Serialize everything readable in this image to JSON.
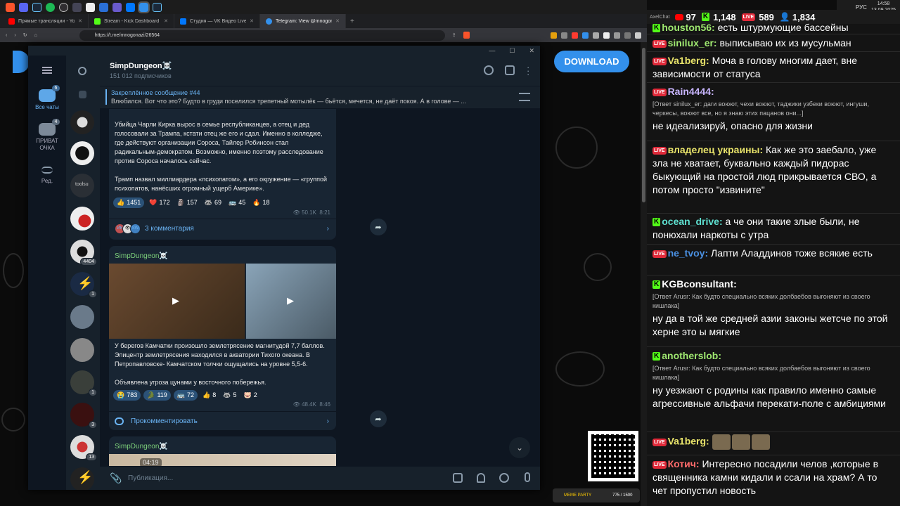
{
  "taskbar": {
    "icons": [
      "brave",
      "discord",
      "steam",
      "spotify",
      "obs",
      "steam-app",
      "epic",
      "telegram",
      "vk",
      "telegram-active",
      "steam2"
    ],
    "tray": {
      "lang": "РУС",
      "time": "14:58",
      "date": "13.09.2025"
    }
  },
  "browser": {
    "tabs": [
      {
        "label": "Прямые трансляции - YouTube Studio",
        "color": "#ff0000"
      },
      {
        "label": "Stream - Kick Dashboard",
        "color": "#53fc18"
      },
      {
        "label": "Студия — VK Видео Live",
        "color": "#0077ff"
      },
      {
        "label": "Telegram: View @mnogonazi",
        "color": "#3390ec"
      }
    ],
    "url": "https://t.me/mnogonazi/26564"
  },
  "webpage": {
    "download_label": "DOWNLOAD"
  },
  "telegram": {
    "rail": [
      {
        "label": "Все чаты",
        "badge": "6"
      },
      {
        "label": "ПРИВАТ\nОЧКА",
        "badge": "4"
      },
      {
        "label": "Ред.",
        "badge": ""
      }
    ],
    "chat_badges": [
      "4404",
      "1",
      "1",
      "3",
      "13"
    ],
    "chat_title": "SimpDungeon☠️",
    "subscribers": "151 012 подписчиков",
    "pinned_title": "Закреплённое сообщение #44",
    "pinned_text": "Влюбился.   Вот что это? Будто в груди поселился трепетный мотылёк — бьётся, мечется, не даёт покоя. А в голове — ...",
    "post1": {
      "para1": "Убийца Чарли Кирка вырос в семье республиканцев, а отец и дед голосовали за Трампа, кстати отец же его и сдал. Именно в колледже, где действуют организации Сороса, Тайлер Робинсон стал радикальным-демократом. Возможно, именно поэтому расследование против Сороса началось сейчас.",
      "para2": "Трамп назвал миллиардера «психопатом», а его окружение — «группой психопатов, нанёсших огромный ущерб Америке».",
      "reactions": [
        {
          "e": "👍",
          "n": "1451"
        },
        {
          "e": "❤️",
          "n": "172"
        },
        {
          "e": "🗿",
          "n": "157"
        },
        {
          "e": "🦝",
          "n": "69"
        },
        {
          "e": "🚌",
          "n": "45"
        },
        {
          "e": "🔥",
          "n": "18"
        }
      ],
      "views": "50.1K",
      "time": "8:21",
      "comments": "3 комментария",
      "avatars": [
        "ИК",
        "👁",
        "SW"
      ]
    },
    "post2": {
      "sender": "SimpDungeon☠️",
      "para1": "У берегов Камчатки произошло землетрясение магнитудой 7,7 баллов. Эпицентр землетрясения находился в акватории Тихого океана. В Петропавловске- Камчатском толчки ощущались на уровне 5,5-6.",
      "para2": "Объявлена угроза цунами у восточного побережья.",
      "reactions": [
        {
          "e": "😭",
          "n": "783"
        },
        {
          "e": "🐊",
          "n": "119"
        },
        {
          "e": "🚌",
          "n": "72"
        },
        {
          "e": "👍",
          "n": "8"
        },
        {
          "e": "🦝",
          "n": "5"
        },
        {
          "e": "🐷",
          "n": "2"
        }
      ],
      "views": "48.4K",
      "time": "8:46",
      "comment_label": "Прокомментировать"
    },
    "post3": {
      "sender": "SimpDungeon☠️",
      "video_time": "04:19"
    },
    "composer_placeholder": "Публикация..."
  },
  "chat": {
    "header": {
      "app": "AxelChat",
      "yt": "97",
      "kick": "1,148",
      "vk": "589",
      "total": "1,834"
    },
    "messages": [
      {
        "src": "kick",
        "name": "houston56:",
        "color": "#9fe870",
        "text": "есть штурмующие бассейны"
      },
      {
        "src": "vk",
        "name": "sinilux_er:",
        "color": "#9fe870",
        "text": "выписываю их из мусульман"
      },
      {
        "src": "vk",
        "name": "Va1berg:",
        "color": "#e8e36a",
        "text": "Моча в голову многим дает, вне зависимости от статуса"
      },
      {
        "src": "vk",
        "name": "Rain4444:",
        "color": "#c9b6ff",
        "reply": "[Ответ sinilux_er: даги воюют, чехи воюют, таджики узбеки воюют, ингуши, черкесы, воюют все, но я знаю этих пацанов они...]",
        "text": "не идеализируй, опасно для жизни"
      },
      {
        "src": "vk",
        "name": "владелец украины:",
        "color": "#e8e36a",
        "text": "Как же это заебало, уже зла не хватает, буквально каждый пидорас быкующий на простой люд прикрывается СВО, а потом просто \"извините\""
      },
      {
        "src": "kick",
        "name": "ocean_drive:",
        "color": "#5ee0d0",
        "text": "а че они такие злые были, не понюхали наркоты с утра"
      },
      {
        "src": "vk",
        "name": "ne_tvoy:",
        "color": "#4a90e2",
        "text": "Лапти Аладдинов тоже всякие есть"
      },
      {
        "src": "kick",
        "name": "KGBconsultant:",
        "color": "#ffffff",
        "reply": "[Ответ Arusr: Как будто специально всяких долбаебов выгоняют из своего кишлака]",
        "text": "ну да в той же средней азии законы жетсче по этой херне это ы мягкие"
      },
      {
        "src": "kick",
        "name": "anotherslob:",
        "color": "#9fe870",
        "reply": "[Ответ Arusr: Как будто специально всяких долбаебов выгоняют из своего кишлака]",
        "text": "ну уезжают с родины как правило именно самые агрессивные альфачи перекати-поле с амбициями"
      },
      {
        "src": "vk",
        "name": "Va1berg:",
        "color": "#e8e36a",
        "text": ""
      },
      {
        "src": "vk",
        "name": "Котич:",
        "color": "#ff6b6b",
        "text": "Интересно посадили челов ,которые в священника камни кидали и ссали на храм? А то чет пропустил новость"
      }
    ],
    "meme_label": "MEME PARTY",
    "meme_count": "775 / 1500"
  },
  "colors": {
    "tg_bg": "#17212b",
    "tg_accent": "#6ab3f3",
    "live": "#e02a3a",
    "kick": "#53fc18"
  }
}
